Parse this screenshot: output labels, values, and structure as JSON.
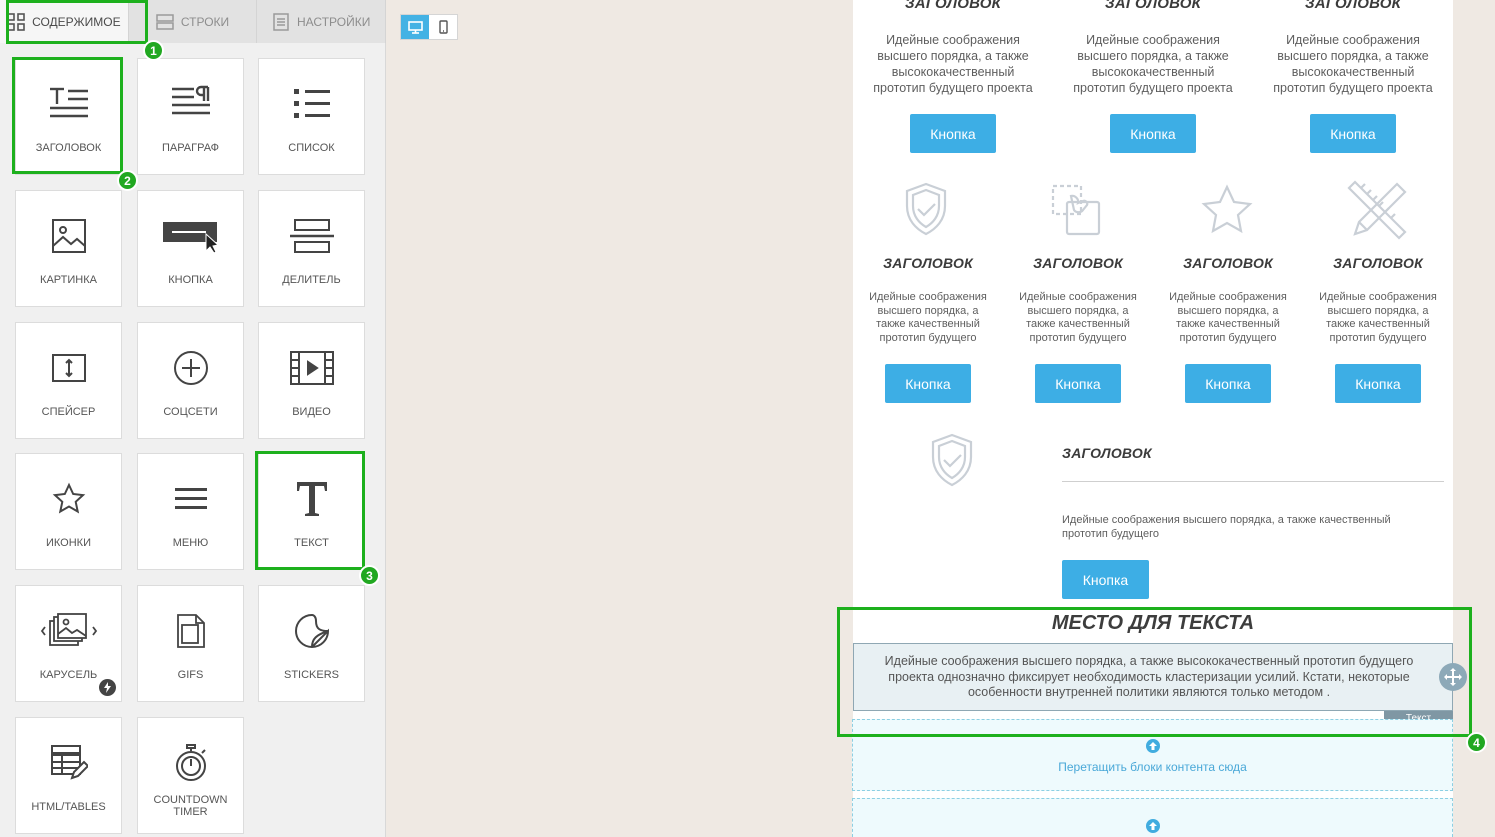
{
  "sidebar": {
    "tabs": [
      {
        "label": "СОДЕРЖИМОЕ",
        "icon": "grid-icon",
        "active": true
      },
      {
        "label": "СТРОКИ",
        "icon": "rows-icon",
        "active": false
      },
      {
        "label": "НАСТРОЙКИ",
        "icon": "settings-doc-icon",
        "active": false
      }
    ],
    "tiles": {
      "heading": {
        "label": "ЗАГОЛОВОК",
        "icon": "heading-icon"
      },
      "paragraph": {
        "label": "ПАРАГРАФ",
        "icon": "paragraph-icon"
      },
      "list": {
        "label": "СПИСОК",
        "icon": "list-icon"
      },
      "image": {
        "label": "КАРТИНКА",
        "icon": "image-icon"
      },
      "button": {
        "label": "КНОПКА",
        "icon": "button-icon"
      },
      "divider": {
        "label": "ДЕЛИТЕЛЬ",
        "icon": "divider-icon"
      },
      "spacer": {
        "label": "СПЕЙСЕР",
        "icon": "spacer-icon"
      },
      "social": {
        "label": "СОЦСЕТИ",
        "icon": "plus-circle-icon"
      },
      "video": {
        "label": "ВИДЕО",
        "icon": "video-icon"
      },
      "icons": {
        "label": "ИКОНКИ",
        "icon": "star-icon"
      },
      "menu": {
        "label": "МЕНЮ",
        "icon": "menu-icon"
      },
      "text": {
        "label": "ТЕКСТ",
        "icon": "text-t-icon"
      },
      "carousel": {
        "label": "КАРУСЕЛЬ",
        "icon": "carousel-icon"
      },
      "gifs": {
        "label": "GIFS",
        "icon": "gif-file-icon"
      },
      "stickers": {
        "label": "STICKERS",
        "icon": "sticker-icon"
      },
      "html": {
        "label": "HTML/TABLES",
        "icon": "table-edit-icon"
      },
      "timer": {
        "label": "COUNTDOWN TIMER",
        "icon": "stopwatch-icon"
      }
    }
  },
  "badges": {
    "b1": "1",
    "b2": "2",
    "b3": "3",
    "b4": "4"
  },
  "canvas": {
    "row1": {
      "heading": "ЗАГОЛОВОК",
      "desc": "Идейные соображения высшего порядка, а также высококачественный прототип будущего проекта",
      "button": "Кнопка"
    },
    "row2": {
      "heading": "ЗАГОЛОВОК",
      "desc": "Идейные соображения высшего порядка, а также качественный прототип будущего",
      "button": "Кнопка",
      "icons": [
        "shield-check-icon",
        "drag-select-icon",
        "star-outline-icon",
        "pencil-ruler-icon"
      ]
    },
    "row3": {
      "heading": "ЗАГОЛОВОК",
      "desc": "Идейные соображения высшего порядка, а также качественный прототип будущего",
      "button": "Кнопка"
    },
    "text_block": {
      "title": "МЕСТО ДЛЯ ТЕКСТА",
      "body": "Идейные соображения высшего порядка, а также высококачественный прототип будущего проекта однозначно фиксирует необходимость кластеризации усилий. Кстати, некоторые особенности внутренней политики являются только методом .",
      "tag": "Текст"
    },
    "drop_zone": {
      "label": "Перетащить блоки контента сюда"
    }
  },
  "colors": {
    "accent": "#3daee5",
    "highlight": "#1db01d",
    "badge": "#21a821"
  }
}
